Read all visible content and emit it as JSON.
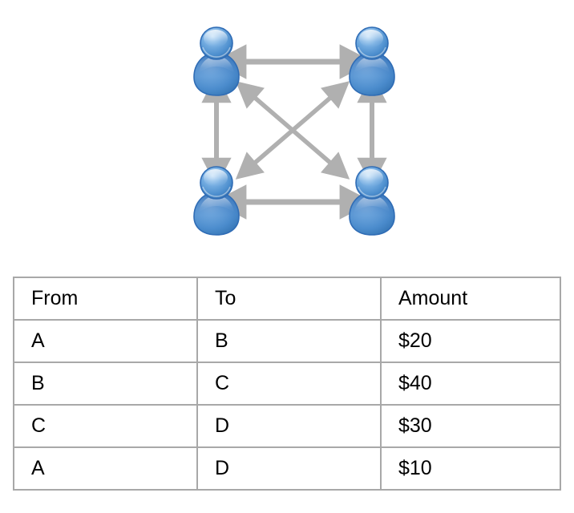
{
  "page": {
    "background_color": "#ffffff"
  },
  "diagram": {
    "name": "four-party-transfer-network",
    "node_icon": "person-icon",
    "node_count": 4,
    "nodes": [
      {
        "id": "top-left",
        "icon": "person-icon"
      },
      {
        "id": "top-right",
        "icon": "person-icon"
      },
      {
        "id": "bottom-left",
        "icon": "person-icon"
      },
      {
        "id": "bottom-right",
        "icon": "person-icon"
      }
    ],
    "edges": [
      {
        "id": "top-edge",
        "from": "top-left",
        "to": "top-right",
        "style": "double-headed-arrow"
      },
      {
        "id": "bottom-edge",
        "from": "bottom-left",
        "to": "bottom-right",
        "style": "double-headed-arrow"
      },
      {
        "id": "left-edge",
        "from": "top-left",
        "to": "bottom-left",
        "style": "double-headed-arrow"
      },
      {
        "id": "right-edge",
        "from": "top-right",
        "to": "bottom-right",
        "style": "double-headed-arrow"
      },
      {
        "id": "diagonal-tl-br",
        "from": "top-left",
        "to": "bottom-right",
        "style": "double-headed-arrow"
      },
      {
        "id": "diagonal-tr-bl",
        "from": "top-right",
        "to": "bottom-left",
        "style": "double-headed-arrow"
      }
    ],
    "colors": {
      "arrow": "#b0b0b0",
      "person_light": "#9fc8f0",
      "person_mid": "#5b9bd5",
      "person_dark": "#2f6cb5",
      "person_outline": "#2f6cb5"
    }
  },
  "table": {
    "name": "transfers-table",
    "columns": [
      "From",
      "To",
      "Amount"
    ],
    "rows": [
      {
        "from": "A",
        "to": "B",
        "amount": "$20"
      },
      {
        "from": "B",
        "to": "C",
        "amount": "$40"
      },
      {
        "from": "C",
        "to": "D",
        "amount": "$30"
      },
      {
        "from": "A",
        "to": "D",
        "amount": "$10"
      }
    ],
    "colors": {
      "border": "#a8a8a8",
      "cell_background": "#ffffff",
      "text": "#000000"
    }
  }
}
